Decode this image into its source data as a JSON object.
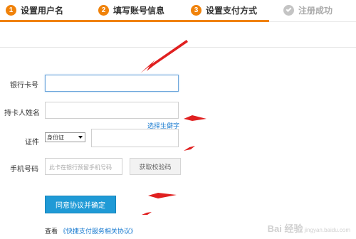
{
  "steps": [
    {
      "num": "1",
      "label": "设置用户名"
    },
    {
      "num": "2",
      "label": "填写账号信息"
    },
    {
      "num": "3",
      "label": "设置支付方式"
    },
    {
      "num": "",
      "label": "注册成功"
    }
  ],
  "form": {
    "card_label": "银行卡号",
    "name_label": "持卡人姓名",
    "rare_char_link": "选择生僻字",
    "id_label": "证件",
    "id_type_selected": "身份证",
    "phone_label": "手机号码",
    "phone_placeholder": "此卡在银行预留手机号码",
    "get_code_button": "获取校验码",
    "submit_button": "同意协议并确定",
    "agreement_prefix": "查看",
    "agreement_link": "《快捷支付服务相关协议》"
  },
  "colors": {
    "accent_orange": "#f0820a",
    "primary_blue": "#1f9ad6",
    "link_blue": "#1a7bd0",
    "annotation_red": "#e02020"
  },
  "watermark": {
    "text": "Bai 经验",
    "sub": "jingyan.baidu.com"
  }
}
